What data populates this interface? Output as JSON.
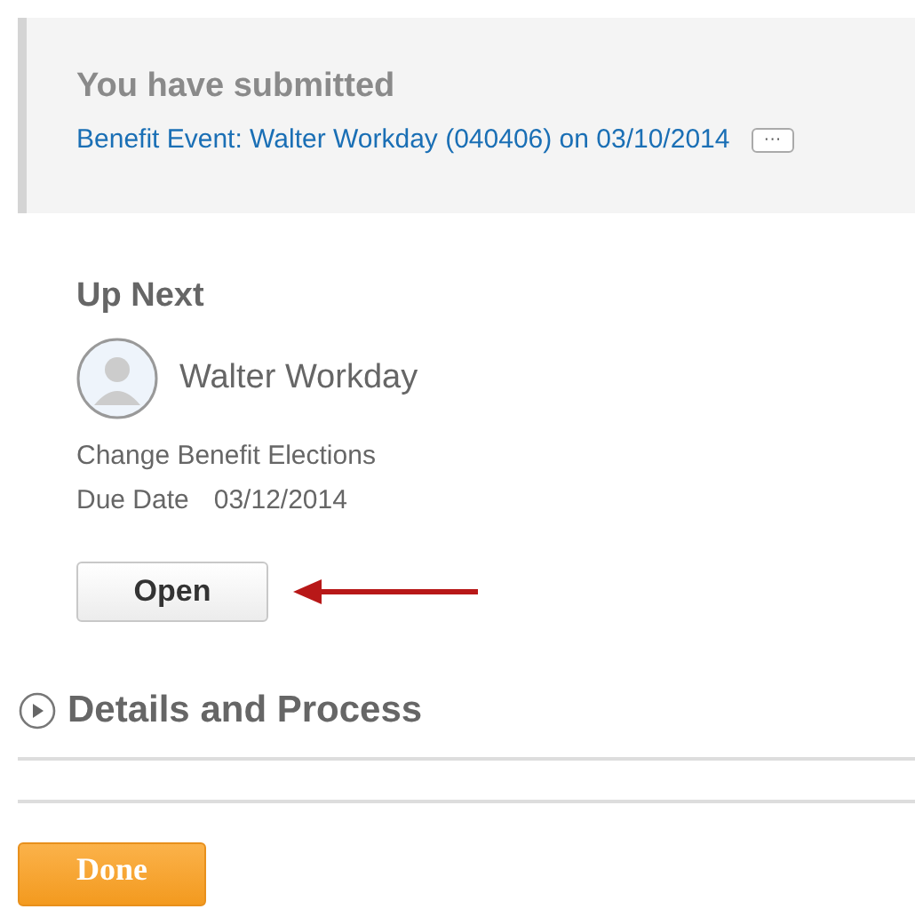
{
  "banner": {
    "title": "You have submitted",
    "link": "Benefit Event: Walter Workday (040406) on 03/10/2014",
    "more_button": "···"
  },
  "up_next": {
    "heading": "Up Next",
    "person": "Walter Workday",
    "task": "Change Benefit Elections",
    "due_label": "Due Date",
    "due_date": "03/12/2014",
    "open_button": "Open"
  },
  "details": {
    "label": "Details and Process",
    "expanded": false
  },
  "done_button": "Done"
}
